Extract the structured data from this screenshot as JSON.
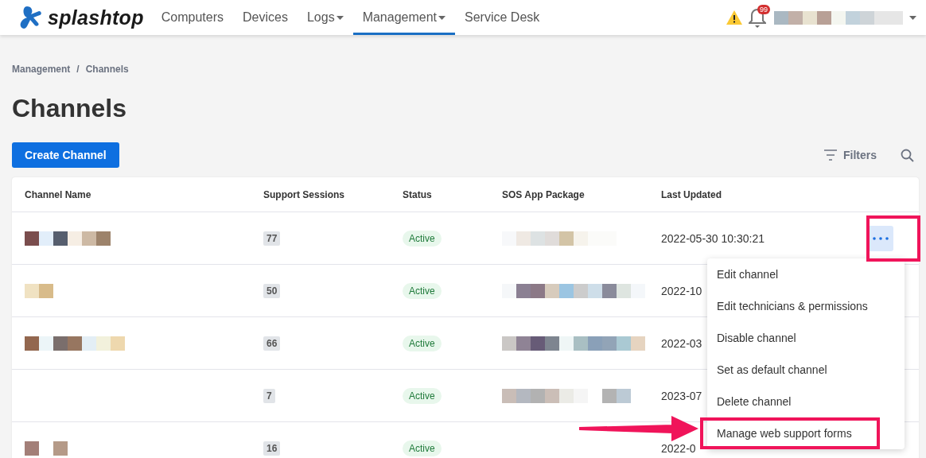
{
  "header": {
    "logo": "splashtop",
    "nav": [
      {
        "label": "Computers",
        "selected": false,
        "dropdown": false
      },
      {
        "label": "Devices",
        "selected": false,
        "dropdown": false
      },
      {
        "label": "Logs",
        "selected": false,
        "dropdown": true
      },
      {
        "label": "Management",
        "selected": true,
        "dropdown": true
      },
      {
        "label": "Service Desk",
        "selected": false,
        "dropdown": false
      }
    ],
    "notification_count": "99"
  },
  "breadcrumb": [
    "Management",
    "Channels"
  ],
  "breadcrumb_separator": "/",
  "title": "Channels",
  "create_button": "Create Channel",
  "filters_label": "Filters",
  "table": {
    "columns": [
      "Channel Name",
      "Support Sessions",
      "Status",
      "SOS App Package",
      "Last Updated"
    ],
    "rows": [
      {
        "sessions": "77",
        "status": "Active",
        "last_updated": "2022-05-30 10:30:21",
        "menu_open": true
      },
      {
        "sessions": "50",
        "status": "Active",
        "last_updated": "2022-10",
        "menu_open": false
      },
      {
        "sessions": "66",
        "status": "Active",
        "last_updated": "2022-03",
        "menu_open": false
      },
      {
        "sessions": "7",
        "status": "Active",
        "last_updated": "2023-07",
        "menu_open": false
      },
      {
        "sessions": "16",
        "status": "Active",
        "last_updated": "2022-0",
        "menu_open": false
      }
    ]
  },
  "row_menu": {
    "items": [
      {
        "label": "Edit channel",
        "annotated": false
      },
      {
        "label": "Edit technicians & permissions",
        "annotated": false
      },
      {
        "label": "Disable channel",
        "annotated": false
      },
      {
        "label": "Set as default channel",
        "annotated": false
      },
      {
        "label": "Delete channel",
        "annotated": false
      },
      {
        "label": "Manage web support forms",
        "annotated": true
      }
    ]
  }
}
